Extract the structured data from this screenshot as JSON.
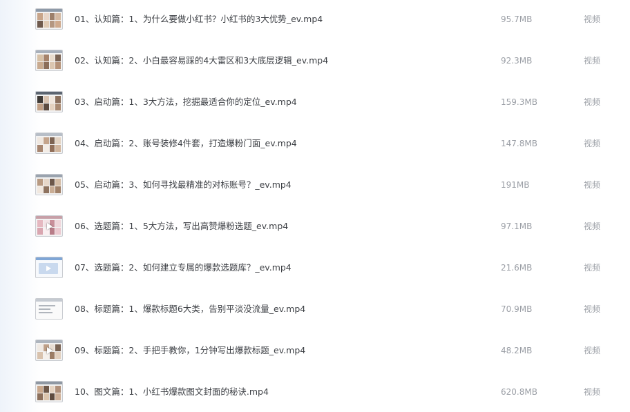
{
  "files": [
    {
      "name": "01、认知篇：1、为什么要做小红书？小红书的3大优势_ev.mp4",
      "size": "95.7MB",
      "type": "视频"
    },
    {
      "name": "02、认知篇：2、小白最容易踩的4大雷区和3大底层逻辑_ev.mp4",
      "size": "92.3MB",
      "type": "视频"
    },
    {
      "name": "03、启动篇：1、3大方法，挖掘最适合你的定位_ev.mp4",
      "size": "159.3MB",
      "type": "视频"
    },
    {
      "name": "04、启动篇：2、账号装修4件套，打造爆粉门面_ev.mp4",
      "size": "147.8MB",
      "type": "视频"
    },
    {
      "name": "05、启动篇：3、如何寻找最精准的对标账号？_ev.mp4",
      "size": "191MB",
      "type": "视频"
    },
    {
      "name": "06、选题篇：1、5大方法，写出高赞爆粉选题_ev.mp4",
      "size": "97.1MB",
      "type": "视频"
    },
    {
      "name": "07、选题篇：2、如何建立专属的爆款选题库？_ev.mp4",
      "size": "21.6MB",
      "type": "视频"
    },
    {
      "name": "08、标题篇：1、爆款标题6大类，告别平淡没流量_ev.mp4",
      "size": "70.9MB",
      "type": "视频"
    },
    {
      "name": "09、标题篇：2、手把手教你，1分钟写出爆款标题_ev.mp4",
      "size": "48.2MB",
      "type": "视频"
    },
    {
      "name": "10、图文篇：1、小红书爆款图文封面的秘诀.mp4",
      "size": "620.8MB",
      "type": "视频"
    }
  ],
  "thumbnail_icon": "video-thumbnail-icon",
  "colors": {
    "name_text": "#3c3f44",
    "meta_text": "#9a9ea5",
    "thumb_border": "#c9ccd1"
  }
}
